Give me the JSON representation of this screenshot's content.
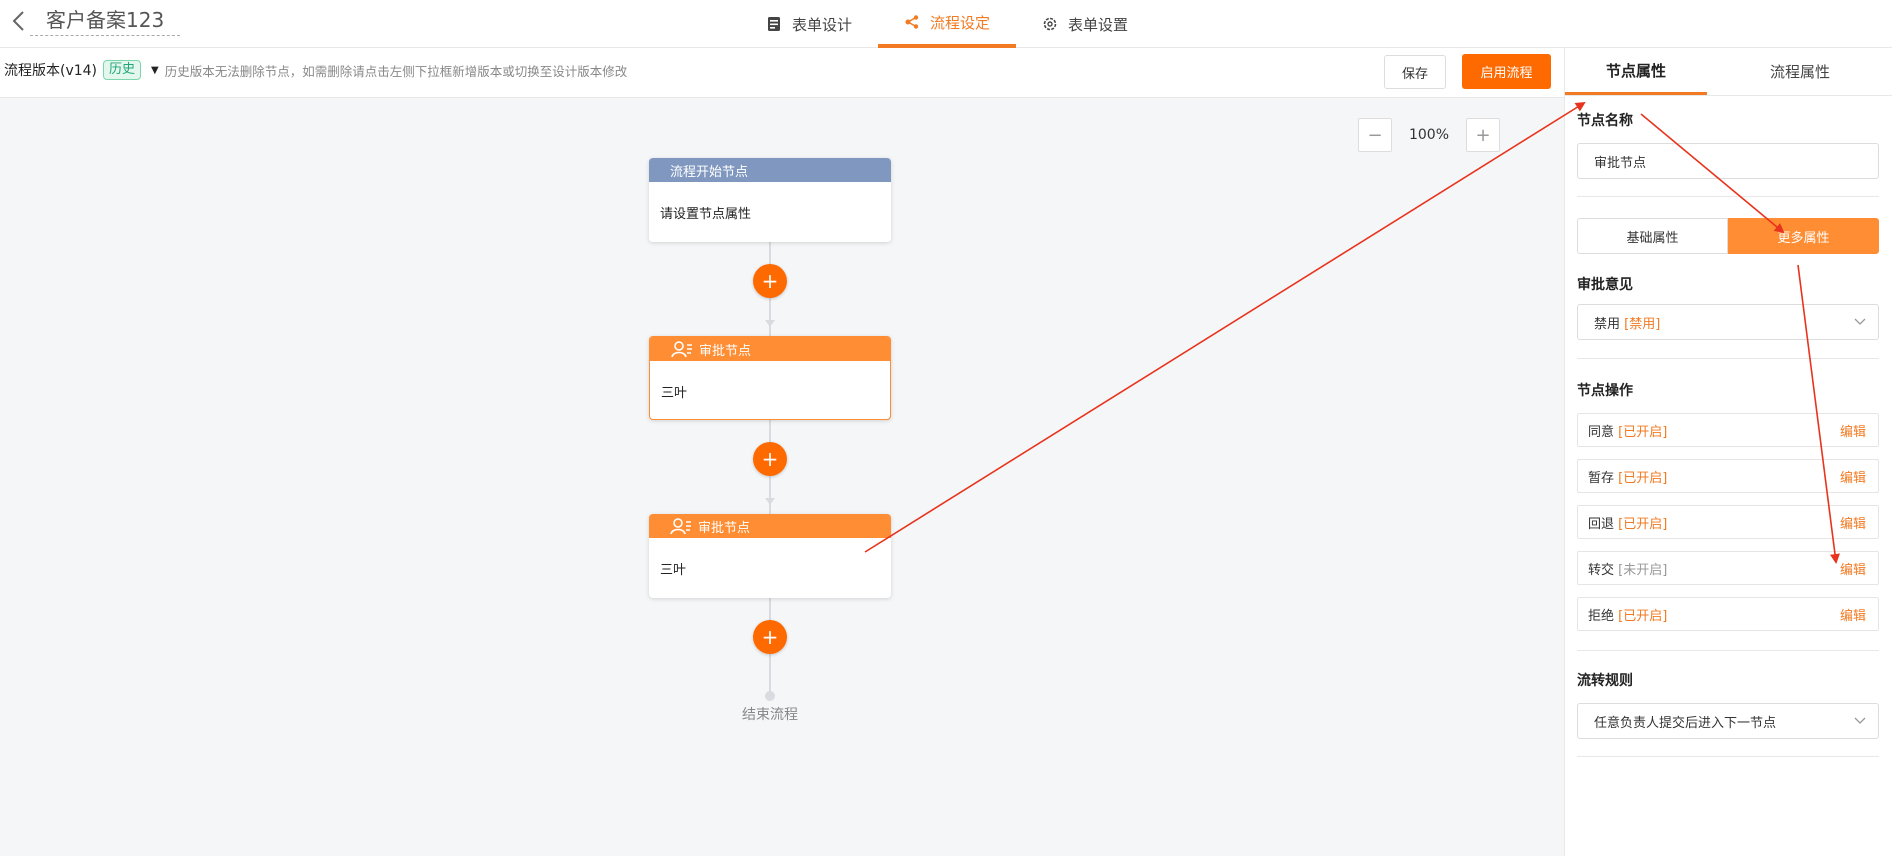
{
  "header": {
    "app_name": "客户备案123",
    "tabs": [
      {
        "label": "表单设计",
        "icon": "form-icon"
      },
      {
        "label": "流程设定",
        "icon": "flow-icon"
      },
      {
        "label": "表单设置",
        "icon": "gear-icon"
      }
    ],
    "active_tab": 1
  },
  "toolbar": {
    "version_label": "流程版本(v14)",
    "version_badge": "历史",
    "hint": "历史版本无法删除节点，如需删除请点击左侧下拉框新增版本或切换至设计版本修改",
    "save_label": "保存",
    "enable_label": "启用流程"
  },
  "canvas": {
    "zoom": "100%",
    "nodes": [
      {
        "type": "start",
        "title": "流程开始节点",
        "body": "请设置节点属性"
      },
      {
        "type": "approval",
        "title": "审批节点",
        "body": "三叶"
      },
      {
        "type": "approval",
        "title": "审批节点",
        "body": "三叶"
      }
    ],
    "end_label": "结束流程"
  },
  "panel": {
    "tabs": [
      "节点属性",
      "流程属性"
    ],
    "active_tab": 0,
    "node_name_label": "节点名称",
    "node_name_value": "审批节点",
    "segments": [
      "基础属性",
      "更多属性"
    ],
    "active_segment": 1,
    "opinion_label": "审批意见",
    "opinion_value": "禁用",
    "opinion_tag": "[禁用]",
    "ops_label": "节点操作",
    "ops": [
      {
        "name": "同意",
        "status": "[已开启]",
        "enabled": true,
        "edit": "编辑"
      },
      {
        "name": "暂存",
        "status": "[已开启]",
        "enabled": true,
        "edit": "编辑"
      },
      {
        "name": "回退",
        "status": "[已开启]",
        "enabled": true,
        "edit": "编辑"
      },
      {
        "name": "转交",
        "status": "[未开启]",
        "enabled": false,
        "edit": "编辑"
      },
      {
        "name": "拒绝",
        "status": "[已开启]",
        "enabled": true,
        "edit": "编辑"
      }
    ],
    "rule_label": "流转规则",
    "rule_value": "任意负责人提交后进入下一节点"
  },
  "colors": {
    "accent": "#ff6a00",
    "approval_header": "#ff8d33",
    "start_header": "#8098bf",
    "annotation": "#e8341c"
  }
}
